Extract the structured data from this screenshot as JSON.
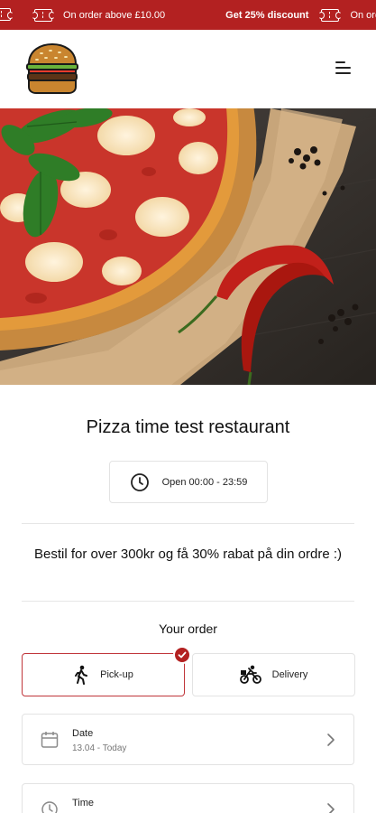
{
  "promo_banner": {
    "items": [
      {
        "text": ""
      },
      {
        "text": "On order above £10.00"
      },
      {
        "text": "Get 25% discount"
      },
      {
        "text": "On orde"
      }
    ],
    "color": "#b32121"
  },
  "header": {
    "logo_icon": "burger-logo",
    "menu_icon": "hamburger-menu-icon"
  },
  "restaurant": {
    "name": "Pizza time test restaurant",
    "hours": "Open 00:00 - 23:59"
  },
  "promo_message": "Bestil for over 300kr og få 30% rabat på din ordre :)",
  "order": {
    "heading": "Your order",
    "options": [
      {
        "label": "Pick-up",
        "icon": "walking-person-icon",
        "selected": true
      },
      {
        "label": "Delivery",
        "icon": "bicycle-courier-icon",
        "selected": false
      }
    ],
    "date": {
      "label": "Date",
      "value": "13.04 - Today",
      "icon": "calendar-icon"
    },
    "time": {
      "label": "Time",
      "value": "",
      "icon": "clock-icon"
    }
  },
  "colors": {
    "accent": "#b32121"
  }
}
